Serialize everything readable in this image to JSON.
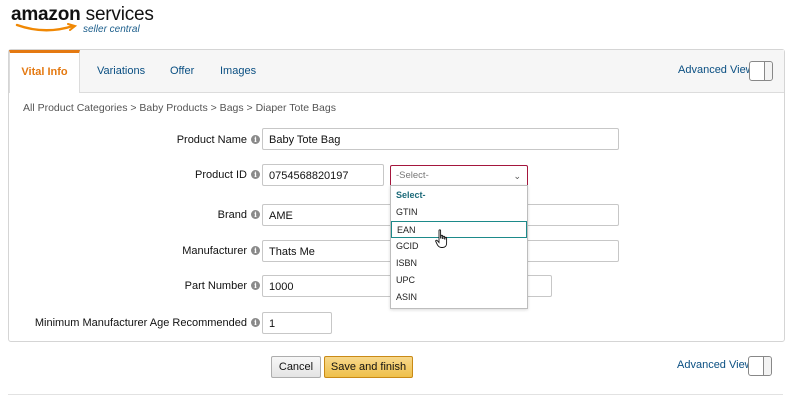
{
  "brand": {
    "logo_main": "amazon",
    "logo_main_suffix": "services",
    "logo_sub": "seller central"
  },
  "tabs": [
    {
      "label": "Vital Info",
      "active": true
    },
    {
      "label": "Variations",
      "active": false
    },
    {
      "label": "Offer",
      "active": false
    },
    {
      "label": "Images",
      "active": false
    }
  ],
  "advanced_view": {
    "label": "Advanced View",
    "enabled": false
  },
  "breadcrumb": "All Product Categories > Baby Products > Bags > Diaper Tote Bags",
  "fields": {
    "product_name": {
      "label": "Product Name",
      "value": "Baby Tote Bag"
    },
    "product_id": {
      "label": "Product ID",
      "value": "0754568820197",
      "type_selected": "-Select-"
    },
    "brand": {
      "label": "Brand",
      "value": "AME"
    },
    "manufacturer": {
      "label": "Manufacturer",
      "value": "Thats Me"
    },
    "part_number": {
      "label": "Part Number",
      "value": "1000"
    },
    "min_age": {
      "label": "Minimum Manufacturer Age Recommended",
      "value": "1"
    }
  },
  "id_type_options": {
    "header": "Select-",
    "options": [
      "GTIN",
      "EAN",
      "GCID",
      "ISBN",
      "UPC",
      "ASIN"
    ],
    "hovered": "EAN"
  },
  "info_glyph": "i",
  "footer": {
    "cancel_label": "Cancel",
    "save_label": "Save and finish",
    "advanced_view_label": "Advanced View"
  },
  "colors": {
    "active_tab": "#e47911",
    "link": "#0a4f82",
    "select_border": "#a4163d",
    "save_button": "#efc04a"
  }
}
